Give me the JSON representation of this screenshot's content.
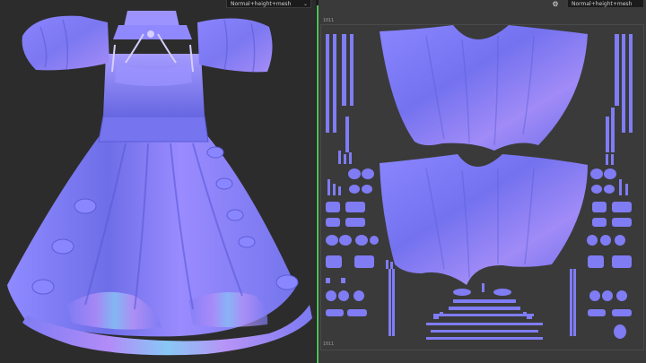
{
  "viewport_3d": {
    "channel_dropdown": "Normal+height+mesh"
  },
  "viewport_2d": {
    "channel_dropdown": "Normal+height+mesh",
    "uv_tile_top_label": "1011",
    "uv_tile_bottom_label": "1011",
    "tool_icon": "settings-dots-icon"
  },
  "colors": {
    "normal_base": "#7e7cf4",
    "normal_light": "#b2a6ff",
    "normal_shadow": "#5f5fe0",
    "accent_active_view": "#4fbf5e",
    "background": "#2a2a2a"
  }
}
